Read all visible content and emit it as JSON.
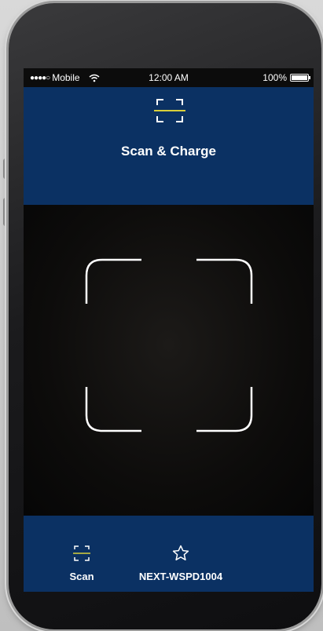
{
  "status_bar": {
    "carrier": "Mobile",
    "signal": "●●●●○",
    "time": "12:00 AM",
    "battery": "100%"
  },
  "header": {
    "icon": "scan-icon",
    "title": "Scan & Charge"
  },
  "scanner": {
    "frame_icon": "scan-frame-corners"
  },
  "tab_bar": {
    "tabs": [
      {
        "label": "Scan",
        "icon": "scan-icon",
        "selected": true
      },
      {
        "label": "NEXT-WSPD1004",
        "icon": "star-icon",
        "selected": false
      }
    ]
  },
  "colors": {
    "brand_navy": "#0b3163",
    "accent_yellow": "#d8cf3a",
    "scan_frame": "#ffffff"
  }
}
